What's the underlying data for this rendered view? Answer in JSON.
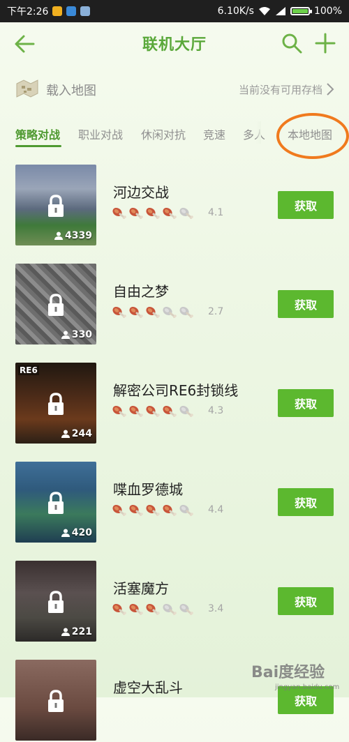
{
  "status_bar": {
    "time": "下午2:26",
    "speed": "6.10K/s",
    "battery": "100%"
  },
  "header": {
    "title": "联机大厅"
  },
  "load_map": {
    "label": "载入地图",
    "status": "当前没有可用存档"
  },
  "tabs": [
    {
      "label": "策略对战",
      "active": true
    },
    {
      "label": "职业对战",
      "active": false
    },
    {
      "label": "休闲对抗",
      "active": false
    },
    {
      "label": "竞速",
      "active": false
    },
    {
      "label": "多人",
      "active": false
    },
    {
      "label": "本地地图",
      "active": false
    }
  ],
  "maps": [
    {
      "name": "河边交战",
      "players": "4339",
      "rating": 4,
      "score": "4.1",
      "button": "获取"
    },
    {
      "name": "自由之梦",
      "players": "330",
      "rating": 3,
      "score": "2.7",
      "button": "获取"
    },
    {
      "name": "解密公司RE6封锁线",
      "players": "244",
      "rating": 4,
      "score": "4.3",
      "button": "获取",
      "thumb_text": "RE6"
    },
    {
      "name": "喋血罗德城",
      "players": "420",
      "rating": 4,
      "score": "4.4",
      "button": "获取"
    },
    {
      "name": "活塞魔方",
      "players": "221",
      "rating": 3,
      "score": "3.4",
      "button": "获取"
    },
    {
      "name": "虚空大乱斗",
      "players": "",
      "rating": 0,
      "score": "",
      "button": "获取"
    }
  ],
  "watermark": {
    "brand": "Bai度经验",
    "sub": "jingyan.baidu.com"
  },
  "colors": {
    "accent": "#5aa83a",
    "button": "#5cb82f",
    "highlight_ring": "#f07a1e"
  }
}
